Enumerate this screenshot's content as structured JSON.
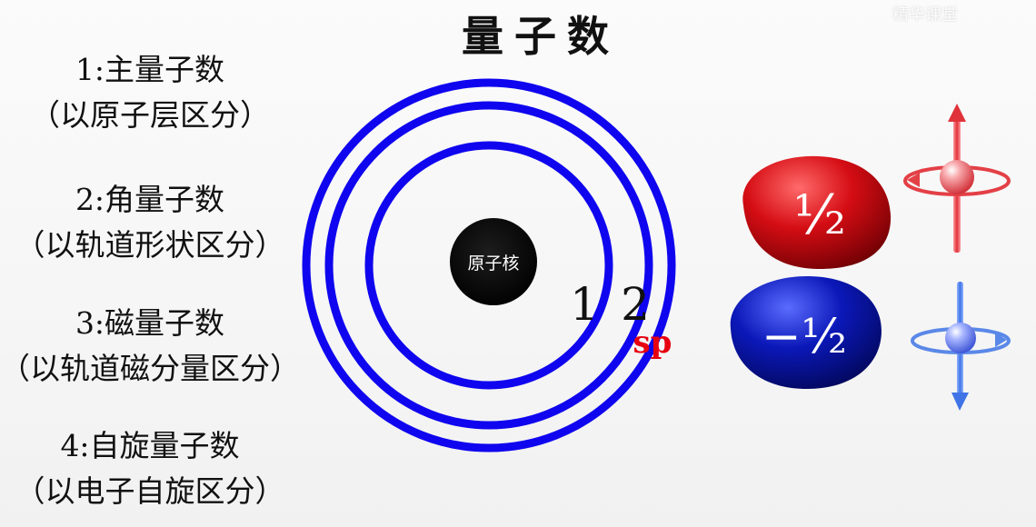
{
  "title": "量子数",
  "watermark": "精华课堂",
  "quantum_numbers": [
    {
      "name": "1:主量子数",
      "desc": "（以原子层区分）"
    },
    {
      "name": "2:角量子数",
      "desc": "（以轨道形状区分）"
    },
    {
      "name": "3:磁量子数",
      "desc": "（以轨道磁分量区分）"
    },
    {
      "name": "4:自旋量子数",
      "desc": "（以电子自旋区分）"
    }
  ],
  "atom": {
    "nucleus_label": "原子核",
    "shell_numbers": [
      "1",
      "2"
    ],
    "subshell_label": "sp",
    "shell_color": "#0f05ee",
    "nucleus_color": "#050505"
  },
  "spin": {
    "up_label": "½",
    "down_label": "−½",
    "up_color": "#cf0a12",
    "down_color": "#0a1aa8"
  }
}
